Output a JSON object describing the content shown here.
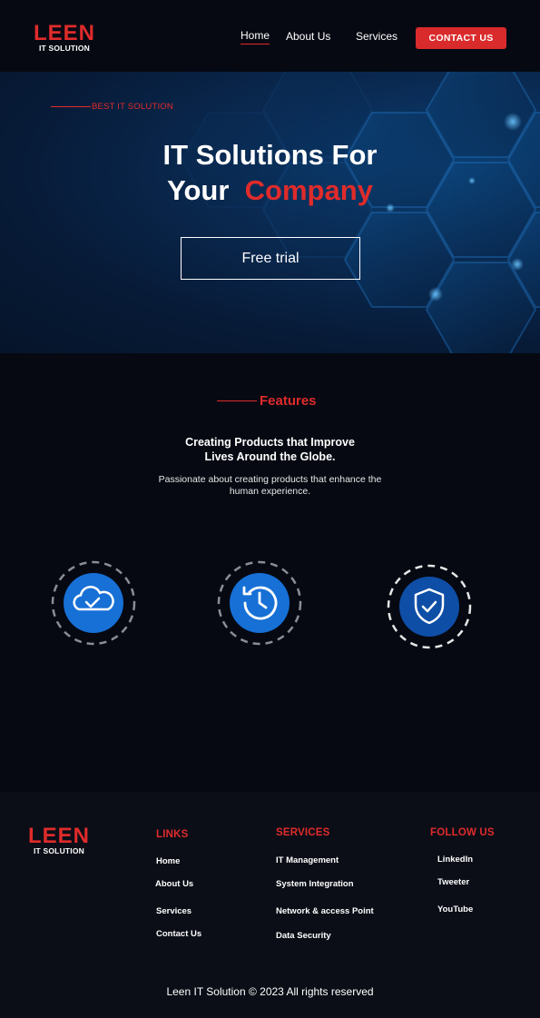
{
  "brand": {
    "name": "LEEN",
    "tagline": "IT SOLUTION",
    "accent_color": "#e02b2b"
  },
  "nav": {
    "items": [
      {
        "label": "Home",
        "active": true
      },
      {
        "label": "About Us"
      },
      {
        "label": "Services"
      }
    ],
    "contact_button": "CONTACT US"
  },
  "hero": {
    "eyebrow": "BEST IT SOLUTION",
    "title_line1": "IT Solutions For",
    "title_line2_prefix": "Your",
    "title_line2_accent": "Company",
    "cta": "Free trial"
  },
  "features": {
    "heading": "Features",
    "subheading_line1": "Creating Products that Improve",
    "subheading_line2": "Lives Around the Globe.",
    "description_line1": "Passionate about creating products that enhance the",
    "description_line2": "human experience.",
    "icons": [
      {
        "icon": "cloud-check-icon"
      },
      {
        "icon": "history-clock-icon"
      },
      {
        "icon": "shield-check-icon"
      }
    ]
  },
  "footer": {
    "links": {
      "title": "LINKS",
      "items": [
        "Home",
        "About Us",
        "Services",
        "Contact Us"
      ]
    },
    "services": {
      "title": "SERVICES",
      "items": [
        "IT Management",
        "System Integration",
        "Network & access Point",
        "Data Security"
      ]
    },
    "follow": {
      "title": "FOLLOW US",
      "items": [
        "LinkedIn",
        "Tweeter",
        "YouTube"
      ]
    },
    "copyright": "Leen IT Solution © 2023 All rights reserved"
  }
}
